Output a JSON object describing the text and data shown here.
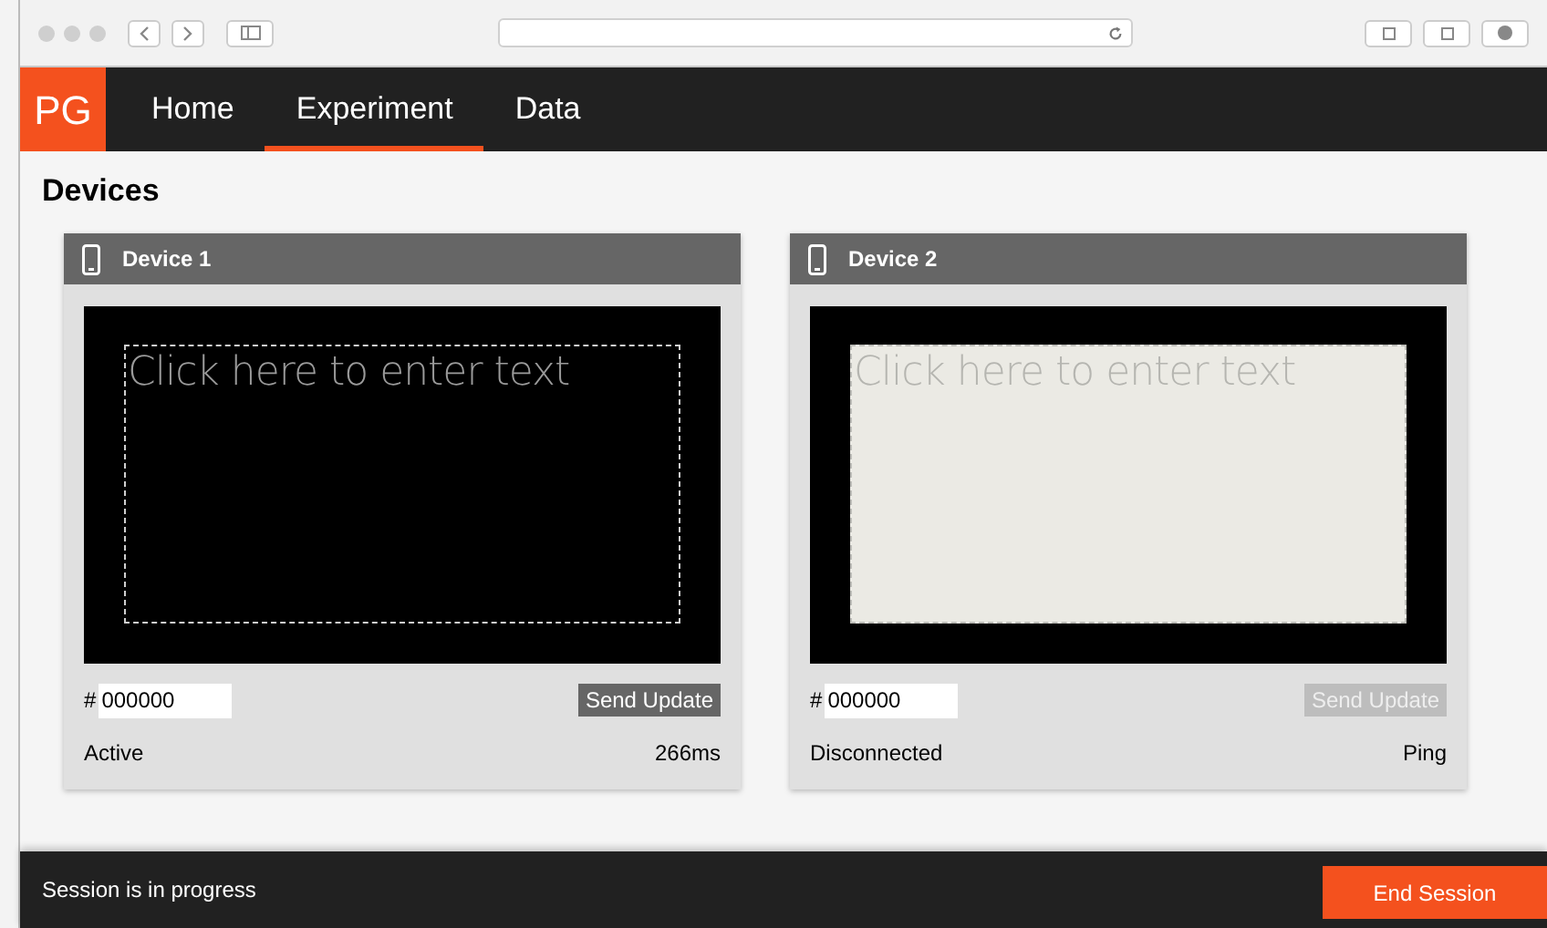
{
  "nav": {
    "logo": "PG",
    "tabs": [
      {
        "label": "Home",
        "selected": false
      },
      {
        "label": "Experiment",
        "selected": true
      },
      {
        "label": "Data",
        "selected": false
      }
    ]
  },
  "page": {
    "heading": "Devices"
  },
  "devices": [
    {
      "name": "Device 1",
      "screen_lit": false,
      "placeholder": "Click here to enter text",
      "hash": "#",
      "color_value": "000000",
      "button": "Send Update",
      "disabled": false,
      "status": "Active",
      "reading": "266ms"
    },
    {
      "name": "Device 2",
      "screen_lit": true,
      "placeholder": "Click here to enter text",
      "hash": "#",
      "color_value": "000000",
      "button": "Send Update",
      "disabled": true,
      "status": "Disconnected",
      "reading": "Ping"
    }
  ],
  "footer": {
    "status": "Session is in progress",
    "button": "End Session"
  }
}
